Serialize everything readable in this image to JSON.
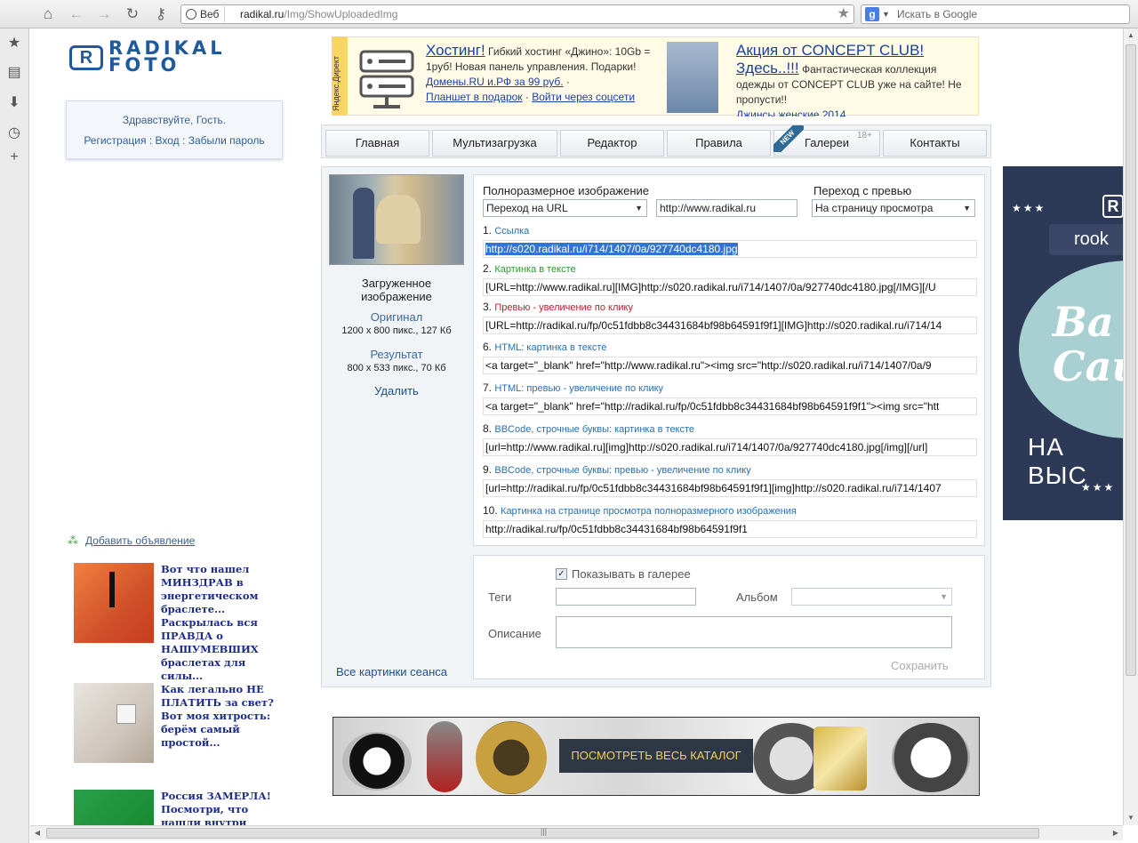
{
  "browser": {
    "address_chip": "Веб",
    "url_host": "radikal.ru",
    "url_path": "/Img/ShowUploadedImg",
    "search_placeholder": "Искать в Google"
  },
  "site": {
    "logo_text_1": "RADIKAL",
    "logo_text_2": "FOTO",
    "greeting": "Здравствуйте, Гость.",
    "register": "Регистрация",
    "login": "Вход",
    "forgot": "Забыли пароль",
    "sep": ":"
  },
  "ad_direct": {
    "tag": "Яндекс.Директ",
    "item1": {
      "title": "Хостинг!",
      "text": " Гибкий хостинг «Джино»: 10Gb = 1руб! Новая панель управления. Подарки!",
      "link1": "Домены.RU и.РФ за 99 руб.",
      "dot": " · ",
      "link2": "Планшет в подарок",
      "link3": "Войти через соцсети"
    },
    "item2": {
      "title": "Акция от CONCEPT CLUB! Здесь..!!!",
      "text": " Фантастическая коллекция одежды от CONCEPT CLUB уже на сайте! Не пропусти!!",
      "link1": "Джинсы женские 2014"
    }
  },
  "nav": {
    "items": [
      "Главная",
      "Мультизагрузка",
      "Редактор",
      "Правила",
      "Галереи",
      "Контакты"
    ],
    "new_badge": "NEW",
    "age_badge": "18+"
  },
  "image_info": {
    "uploaded_label": "Загруженное изображение",
    "original_label": "Оригинал",
    "original_value": "1200 x 800 пикс., 127 Кб",
    "result_label": "Результат",
    "result_value": "800 x 533 пикс., 70 Кб",
    "delete": "Удалить",
    "all_pics": "Все картинки сеанса"
  },
  "settings": {
    "fullsize_label": "Полноразмерное изображение",
    "fullsize_select": "Переход на URL",
    "fullsize_url": "http://www.radikal.ru",
    "preview_label": "Переход с превью",
    "preview_select": "На страницу просмотра"
  },
  "codes": [
    {
      "num": "1.",
      "caption": "Ссылка",
      "color": "#2a6fb0",
      "value": "http://s020.radikal.ru/i714/1407/0a/927740dc4180.jpg",
      "selected": true
    },
    {
      "num": "2.",
      "caption": "Картинка в тексте",
      "color": "#2e9a2e",
      "value": "[URL=http://www.radikal.ru][IMG]http://s020.radikal.ru/i714/1407/0a/927740dc4180.jpg[/IMG][/U"
    },
    {
      "num": "3.",
      "caption": "Превью - увеличение по клику",
      "color": "#b8202a",
      "value": "[URL=http://radikal.ru/fp/0c51fdbb8c34431684bf98b64591f9f1][IMG]http://s020.radikal.ru/i714/14"
    },
    {
      "num": "6.",
      "caption": "HTML: картинка в тексте",
      "color": "#2a6fb0",
      "value": "<a target=\"_blank\" href=\"http://www.radikal.ru\"><img src=\"http://s020.radikal.ru/i714/1407/0a/9"
    },
    {
      "num": "7.",
      "caption": "HTML: превью - увеличение по клику",
      "color": "#2a6fb0",
      "value": "<a target=\"_blank\" href=\"http://radikal.ru/fp/0c51fdbb8c34431684bf98b64591f9f1\"><img src=\"htt"
    },
    {
      "num": "8.",
      "caption": "BBCode, строчные буквы: картинка в тексте",
      "color": "#2a6fb0",
      "value": "[url=http://www.radikal.ru][img]http://s020.radikal.ru/i714/1407/0a/927740dc4180.jpg[/img][/url]"
    },
    {
      "num": "9.",
      "caption": "BBCode, строчные буквы: превью - увеличение по клику",
      "color": "#2a6fb0",
      "value": "[url=http://radikal.ru/fp/0c51fdbb8c34431684bf98b64591f9f1][img]http://s020.radikal.ru/i714/1407"
    },
    {
      "num": "10.",
      "caption": "Картинка на странице просмотра полноразмерного изображения",
      "color": "#2a6fb0",
      "value": "http://radikal.ru/fp/0c51fdbb8c34431684bf98b64591f9f1"
    }
  ],
  "gallery": {
    "show_in_gallery": "Показывать в галерее",
    "show_checked": true,
    "tags_label": "Теги",
    "album_label": "Альбом",
    "description_label": "Описание",
    "save": "Сохранить"
  },
  "bottom_banner": {
    "button": "ПОСМОТРЕТЬ ВЕСЬ КАТАЛОГ"
  },
  "right_banner": {
    "brand": "rook",
    "script": "Ва Сай",
    "caption": "НА ВЫС"
  },
  "teasers": {
    "add_ad": "Добавить объявление",
    "items": [
      {
        "text": "Вот что нашел МИНЗДРАВ в энергетическом браслете... Раскрылась вся ПРАВДА о НАШУМЕВШИХ браслетах для силы..."
      },
      {
        "text": "Как легально НЕ ПЛАТИТЬ за свет? Вот моя хитрость: берём самый простой..."
      },
      {
        "text": "Россия ЗАМЕРЛА! Посмотри, что нашли внутри браслетов..."
      }
    ]
  }
}
